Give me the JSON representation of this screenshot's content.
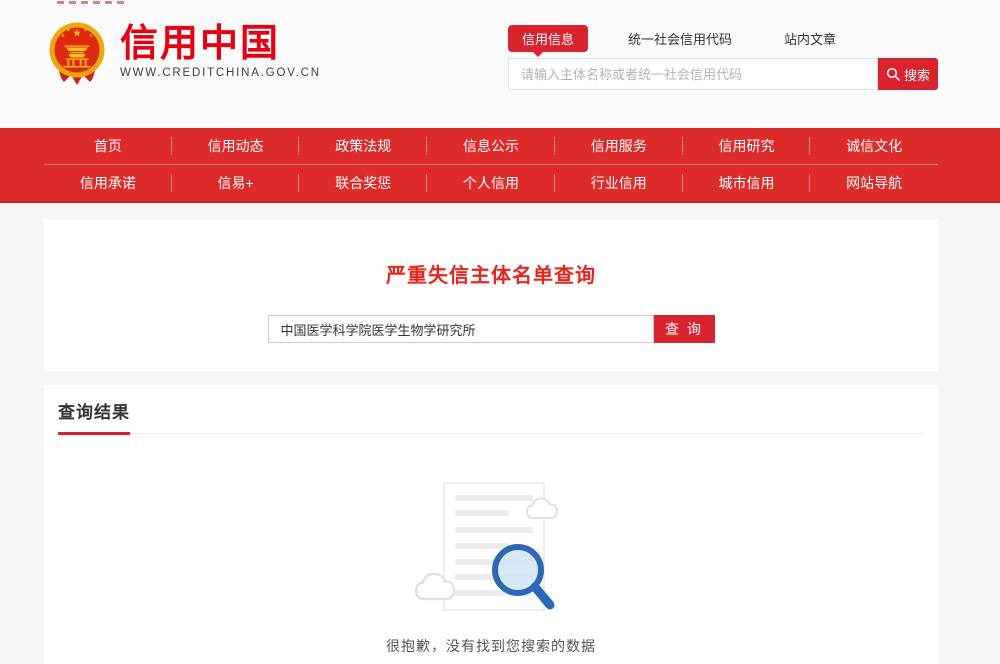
{
  "colors": {
    "brand_red": "#d9232e",
    "nav_red": "#dd2b2b",
    "logo_red": "#e60012",
    "heading_red": "#e6251d",
    "background_gray": "#f5f5f5",
    "magnifier_blue": "#2a6ab5"
  },
  "header": {
    "logo_title": "信用中国",
    "logo_subtitle": "WWW.CREDITCHINA.GOV.CN",
    "tabs": [
      {
        "label": "信用信息",
        "active": true
      },
      {
        "label": "统一社会信用代码",
        "active": false
      },
      {
        "label": "站内文章",
        "active": false
      }
    ],
    "search": {
      "placeholder": "请输入主体名称或者统一社会信用代码",
      "button_label": "搜索"
    }
  },
  "nav": {
    "row1": [
      "首页",
      "信用动态",
      "政策法规",
      "信息公示",
      "信用服务",
      "信用研究",
      "诚信文化"
    ],
    "row2": [
      "信用承诺",
      "信易+",
      "联合奖惩",
      "个人信用",
      "行业信用",
      "城市信用",
      "网站导航"
    ]
  },
  "query_section": {
    "title": "严重失信主体名单查询",
    "input_value": "中国医学科学院医学生物学研究所",
    "button_label": "查 询"
  },
  "results_section": {
    "title": "查询结果",
    "empty_message": "很抱歉，没有找到您搜索的数据"
  }
}
